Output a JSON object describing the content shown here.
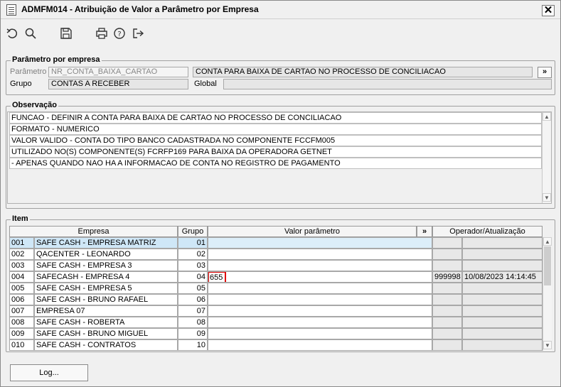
{
  "window": {
    "title": "ADMFM014 - Atribuição de Valor a Parâmetro por Empresa",
    "close_label": "✕"
  },
  "toolbar": {
    "icons": [
      "undo-icon",
      "search-icon",
      "save-icon",
      "print-icon",
      "help-icon",
      "exit-icon"
    ]
  },
  "parametro": {
    "section_title": "Parâmetro por empresa",
    "parametro_label": "Parâmetro",
    "parametro_value": "NR_CONTA_BAIXA_CARTAO",
    "descricao_value": "CONTA PARA BAIXA DE CARTAO NO PROCESSO DE CONCILIACAO",
    "more_label": "»",
    "grupo_label": "Grupo",
    "grupo_value": "CONTAS A RECEBER",
    "global_label": "Global",
    "global_value": ""
  },
  "observacao": {
    "section_title": "Observação",
    "lines": [
      "FUNCAO - DEFINIR A CONTA PARA BAIXA DE CARTAO NO PROCESSO DE CONCILIACAO",
      "FORMATO - NUMERICO",
      "VALOR VALIDO - CONTA DO TIPO BANCO CADASTRADA NO COMPONENTE FCCFM005",
      "UTILIZADO NO(S) COMPONENTE(S) FCRFP169  PARA  BAIXA DA OPERADORA GETNET",
      "    - APENAS QUANDO NAO HA A INFORMACAO DE CONTA NO REGISTRO DE PAGAMENTO"
    ]
  },
  "item": {
    "section_title": "Item",
    "headers": {
      "empresa": "Empresa",
      "grupo": "Grupo",
      "valor": "Valor parâmetro",
      "more": "»",
      "operador": "Operador/Atualização"
    },
    "rows": [
      {
        "code": "001",
        "empresa": "SAFE CASH - EMPRESA MATRIZ",
        "grupo": "01",
        "valor": "",
        "operador": "",
        "atualizacao": ""
      },
      {
        "code": "002",
        "empresa": "QACENTER - LEONARDO",
        "grupo": "02",
        "valor": "",
        "operador": "",
        "atualizacao": ""
      },
      {
        "code": "003",
        "empresa": "SAFE CASH -  EMPRESA 3",
        "grupo": "03",
        "valor": "",
        "operador": "",
        "atualizacao": ""
      },
      {
        "code": "004",
        "empresa": "SAFECASH -  EMPRESA 4",
        "grupo": "04",
        "valor": "655",
        "operador": "999998",
        "atualizacao": "10/08/2023 14:14:45"
      },
      {
        "code": "005",
        "empresa": "SAFE CASH -  EMPRESA 5",
        "grupo": "05",
        "valor": "",
        "operador": "",
        "atualizacao": ""
      },
      {
        "code": "006",
        "empresa": "SAFE CASH - BRUNO RAFAEL",
        "grupo": "06",
        "valor": "",
        "operador": "",
        "atualizacao": ""
      },
      {
        "code": "007",
        "empresa": "EMPRESA 07",
        "grupo": "07",
        "valor": "",
        "operador": "",
        "atualizacao": ""
      },
      {
        "code": "008",
        "empresa": "SAFE CASH - ROBERTA",
        "grupo": "08",
        "valor": "",
        "operador": "",
        "atualizacao": ""
      },
      {
        "code": "009",
        "empresa": "SAFE CASH - BRUNO MIGUEL",
        "grupo": "09",
        "valor": "",
        "operador": "",
        "atualizacao": ""
      },
      {
        "code": "010",
        "empresa": "SAFE CASH - CONTRATOS",
        "grupo": "10",
        "valor": "",
        "operador": "",
        "atualizacao": ""
      }
    ]
  },
  "footer": {
    "log_label": "Log..."
  }
}
